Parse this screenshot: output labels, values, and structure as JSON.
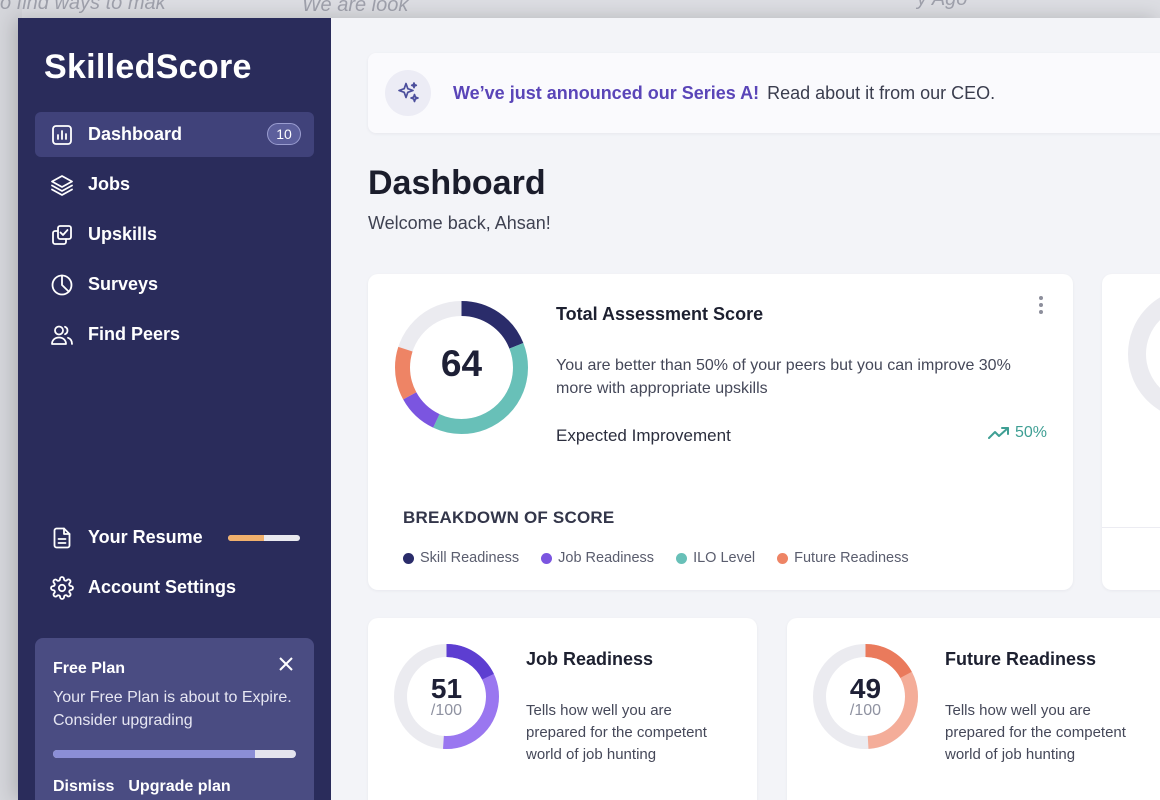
{
  "background": {
    "snippet_1": "o find ways to mak",
    "snippet_2": "We are look",
    "snippet_3": "y Ago"
  },
  "sidebar": {
    "logo": "SkilledScore",
    "items": [
      {
        "label": "Dashboard",
        "icon": "bar-chart-icon",
        "badge": "10",
        "active": true
      },
      {
        "label": "Jobs",
        "icon": "layers-icon"
      },
      {
        "label": "Upskills",
        "icon": "copy-check-icon"
      },
      {
        "label": "Surveys",
        "icon": "pie-chart-icon"
      },
      {
        "label": "Find Peers",
        "icon": "users-icon"
      }
    ],
    "bottom_items": [
      {
        "label": "Your Resume",
        "icon": "document-icon",
        "progress": 0.5
      },
      {
        "label": "Account Settings",
        "icon": "gear-icon"
      }
    ],
    "plan": {
      "title": "Free Plan",
      "text": "Your Free Plan is about to Expire. Consider upgrading",
      "progress": 0.83,
      "dismiss": "Dismiss",
      "upgrade": "Upgrade plan"
    }
  },
  "banner": {
    "icon": "sparkles-icon",
    "strong": "We’ve just announced our Series A!",
    "text": "Read about it from our CEO."
  },
  "header": {
    "title": "Dashboard",
    "subtitle": "Welcome back, Ahsan!"
  },
  "total_score": {
    "value": "64",
    "title": "Total Assessment Score",
    "description": "You are better than 50% of your peers but you can improve 30% more with appropriate upskills",
    "expected_label": "Expected Improvement",
    "expected_value": "50%",
    "breakdown_title": "BREAKDOWN OF SCORE",
    "segments": [
      {
        "name": "Skill Readiness",
        "color": "#2a2c6a",
        "fraction": 0.19
      },
      {
        "name": "ILO Level",
        "color": "#68c0b8",
        "fraction": 0.38
      },
      {
        "name": "Job Readiness",
        "color": "#7b55e0",
        "fraction": 0.1
      },
      {
        "name": "Future Readiness",
        "color": "#ee8465",
        "fraction": 0.13
      }
    ],
    "legend": [
      {
        "label": "Skill Readiness",
        "color": "#2a2c6a"
      },
      {
        "label": "Job Readiness",
        "color": "#7b55e0"
      },
      {
        "label": "ILO Level",
        "color": "#68c0b8"
      },
      {
        "label": "Future Readiness",
        "color": "#ee8465"
      }
    ]
  },
  "job_readiness": {
    "value": "51",
    "max": "/100",
    "fraction": 0.51,
    "title": "Job Readiness",
    "description": "Tells how well you are prepared for the competent world of job hunting",
    "colors": [
      "#5d3ed1",
      "#9a77f0"
    ]
  },
  "future_readiness": {
    "value": "49",
    "max": "/100",
    "fraction": 0.49,
    "title": "Future Readiness",
    "description": "Tells how well you are prepared for the competent world of job hunting",
    "colors": [
      "#ea7a5c",
      "#f4ad99"
    ]
  }
}
